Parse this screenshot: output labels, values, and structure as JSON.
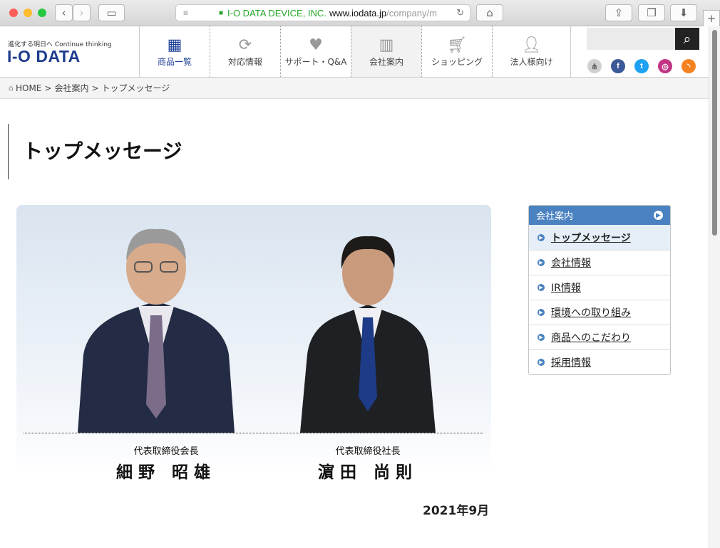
{
  "browser": {
    "url_org": "I-O DATA DEVICE, INC.",
    "url_domain": "www.iodata.jp",
    "url_path": "/company/m"
  },
  "logo": {
    "tagline": "進化する明日へ Continue thinking",
    "name": "I-O DATA"
  },
  "nav": [
    {
      "label": "商品一覧",
      "icon": "grid-icon"
    },
    {
      "label": "対応情報",
      "icon": "refresh-icon"
    },
    {
      "label": "サポート・Q&A",
      "icon": "heart-icon"
    },
    {
      "label": "会社案内",
      "icon": "building-icon"
    },
    {
      "label": "ショッピング",
      "icon": "cart-icon"
    },
    {
      "label": "法人様向け",
      "icon": "person-icon"
    }
  ],
  "social": [
    {
      "name": "sitemap-icon",
      "color": "#d0d0d0"
    },
    {
      "name": "facebook-icon",
      "color": "#3b5998"
    },
    {
      "name": "twitter-icon",
      "color": "#1da1f2"
    },
    {
      "name": "instagram-icon",
      "color": "#c13584"
    },
    {
      "name": "rss-icon",
      "color": "#f58220"
    }
  ],
  "breadcrumb": {
    "home": "HOME",
    "sep": ">",
    "level1": "会社案内",
    "current": "トップメッセージ"
  },
  "page_title": "トップメッセージ",
  "executives": [
    {
      "role": "代表取締役会長",
      "name": "細野 昭雄"
    },
    {
      "role": "代表取締役社長",
      "name": "濵田 尚則"
    }
  ],
  "date": "2021年9月",
  "sidebar": {
    "heading": "会社案内",
    "items": [
      {
        "label": "トップメッセージ"
      },
      {
        "label": "会社情報"
      },
      {
        "label": "IR情報"
      },
      {
        "label": "環境への取り組み"
      },
      {
        "label": "商品へのこだわり"
      },
      {
        "label": "採用情報"
      }
    ]
  },
  "colors": {
    "brand": "#1e3c8f",
    "sidebar_accent": "#4a82c1"
  }
}
